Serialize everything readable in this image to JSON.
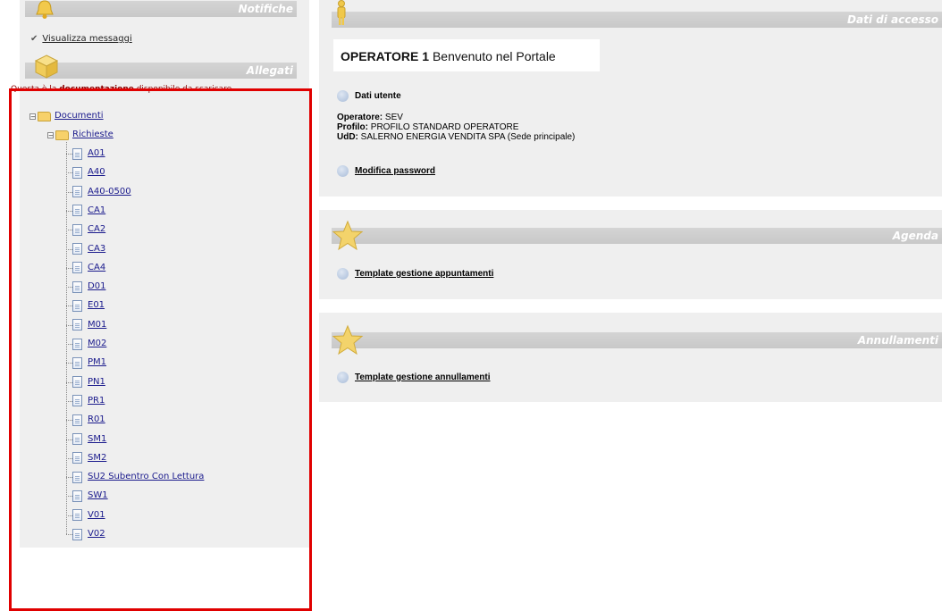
{
  "left": {
    "notifiche_title": "Notifiche",
    "visualizza_messaggi": "Visualizza messaggi",
    "allegati_title": "Allegati",
    "notice_prefix": "Questa è la ",
    "notice_bold": "documentazione",
    "notice_suffix": " disponibile da scaricare.",
    "tree": {
      "root": "Documenti",
      "folder": "Richieste",
      "files": [
        "A01",
        "A40",
        "A40-0500",
        "CA1",
        "CA2",
        "CA3",
        "CA4",
        "D01",
        "E01",
        "M01",
        "M02",
        "PM1",
        "PN1",
        "PR1",
        "R01",
        "SM1",
        "SM2",
        "SU2 Subentro Con Lettura",
        "SW1",
        "V01",
        "V02"
      ]
    }
  },
  "right": {
    "accesso_title": "Dati di accesso",
    "welcome_bold": "OPERATORE 1",
    "welcome_rest": " Benvenuto nel Portale",
    "dati_utente": "Dati utente",
    "operatore_label": "Operatore:",
    "operatore_value": " SEV",
    "profilo_label": "Profilo:",
    "profilo_value": " PROFILO STANDARD OPERATORE",
    "udd_label": "UdD:",
    "udd_value": " SALERNO ENERGIA VENDITA SPA (Sede principale)",
    "modifica_password": "Modifica password",
    "agenda_title": "Agenda",
    "template_appuntamenti": "Template gestione appuntamenti",
    "annullamenti_title": "Annullamenti",
    "template_annullamenti": "Template gestione annullamenti"
  },
  "colors": {
    "selection_border": "#e00000",
    "header_bar": "#cccccc",
    "panel_bg": "#efefef"
  }
}
